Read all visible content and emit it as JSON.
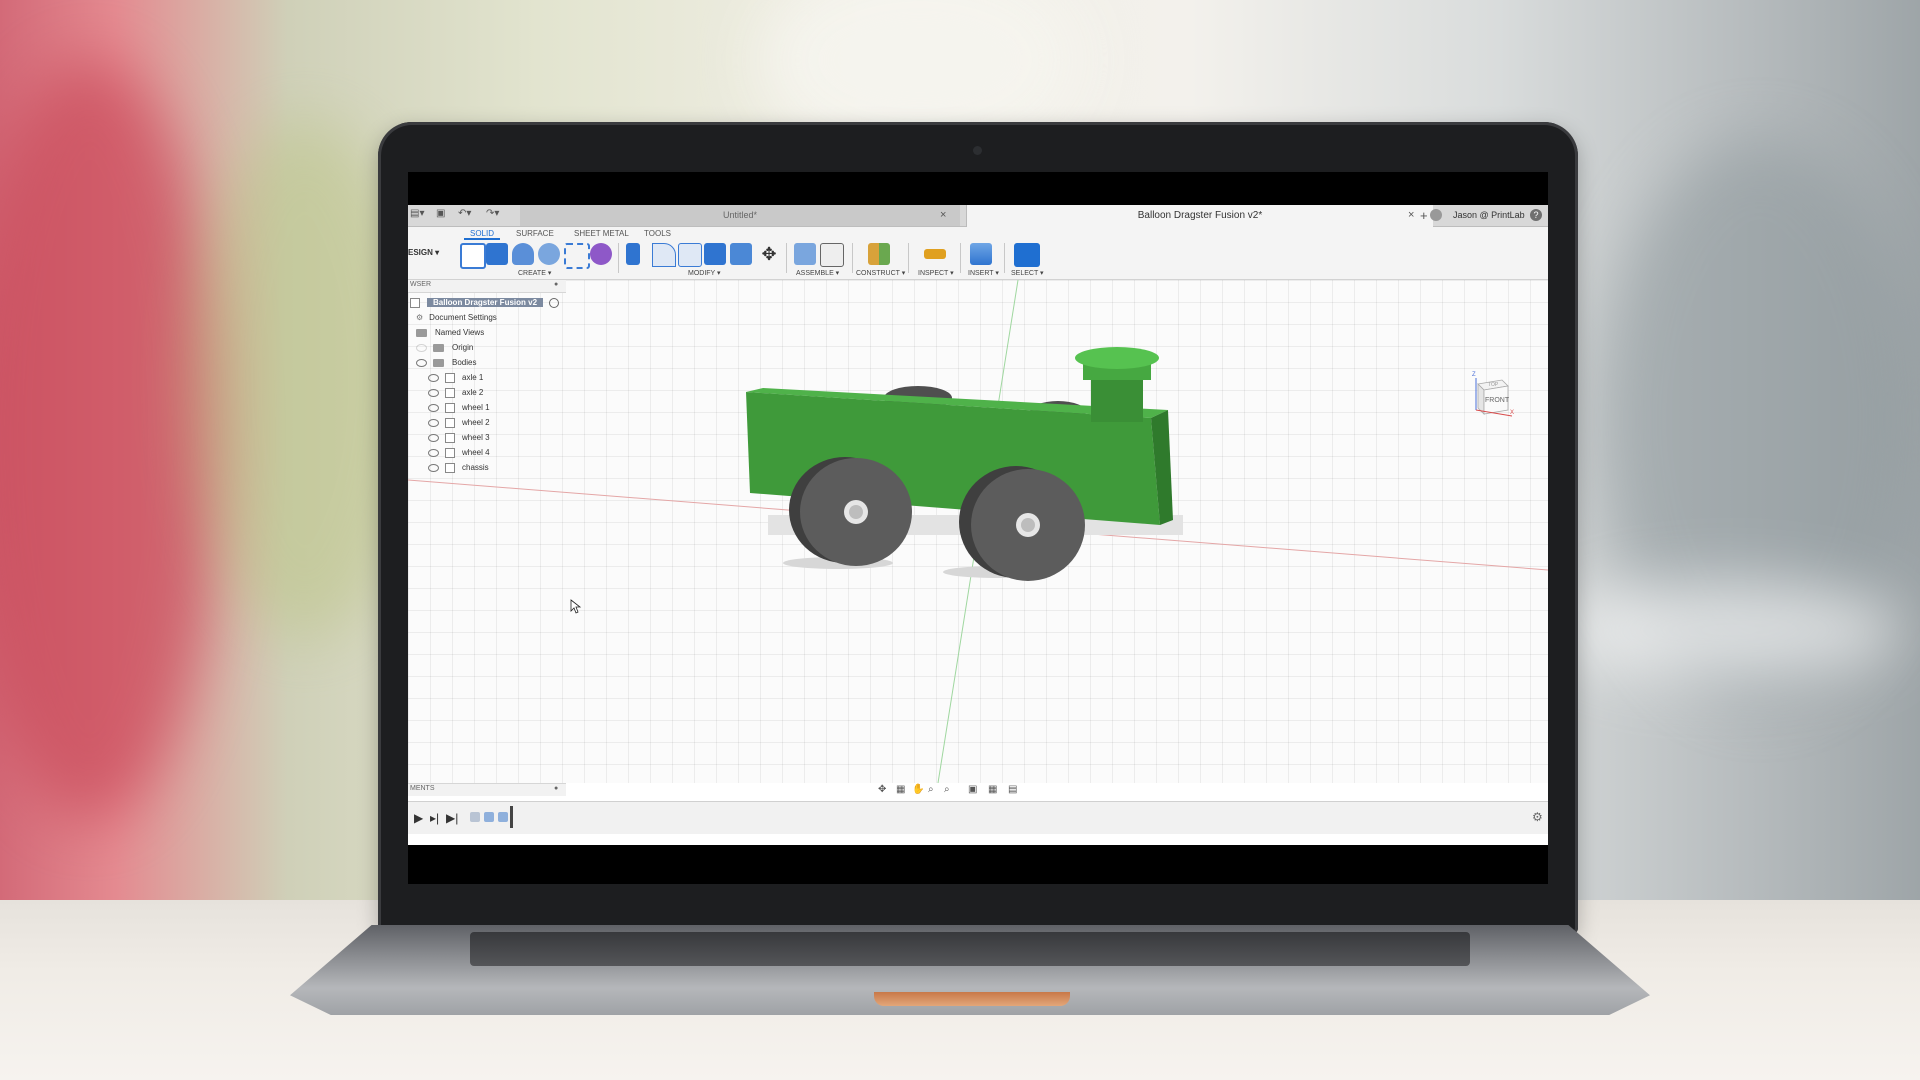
{
  "window": {
    "inactive_tab": "Untitled*",
    "active_tab": "Balloon Dragster Fusion v2*",
    "user": "Jason @ PrintLab",
    "help_icon": "help-icon",
    "close_glyph": "×",
    "add_tab_glyph": "+"
  },
  "workspace": {
    "mode": "ESIGN ▾",
    "tabs": [
      "SOLID",
      "SURFACE",
      "SHEET METAL",
      "TOOLS"
    ],
    "active_tab": "SOLID",
    "groups": [
      "CREATE ▾",
      "MODIFY ▾",
      "ASSEMBLE ▾",
      "CONSTRUCT ▾",
      "INSPECT ▾",
      "INSERT ▾",
      "SELECT ▾"
    ]
  },
  "browser": {
    "header": "WSER",
    "document": "Balloon Dragster Fusion v2",
    "items": [
      {
        "label": "Document Settings",
        "kind": "gear"
      },
      {
        "label": "Named Views",
        "kind": "folder"
      },
      {
        "label": "Origin",
        "kind": "folder"
      },
      {
        "label": "Bodies",
        "kind": "folder"
      }
    ],
    "bodies": [
      "axle 1",
      "axle 2",
      "wheel 1",
      "wheel 2",
      "wheel 3",
      "wheel 4",
      "chassis"
    ]
  },
  "comments": {
    "header": "MENTS"
  },
  "viewcube": {
    "face": "FRONT",
    "axis_z": "Z",
    "axis_x": "X",
    "top": "TOP"
  },
  "colors": {
    "accent": "#1f6fd1",
    "body_green": "#3f9a3a",
    "wheel_gray": "#555555"
  }
}
